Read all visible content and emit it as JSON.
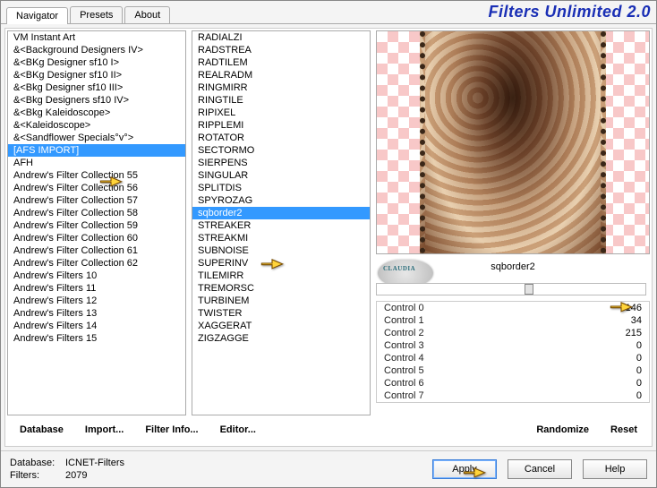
{
  "banner": "Filters Unlimited 2.0",
  "tabs": {
    "t0": "Navigator",
    "t1": "Presets",
    "t2": "About"
  },
  "categories": [
    "VM Instant Art",
    "&<Background Designers IV>",
    "&<BKg Designer sf10 I>",
    "&<BKg Designer sf10 II>",
    "&<Bkg Designer sf10 III>",
    "&<Bkg Designers sf10 IV>",
    "&<Bkg Kaleidoscope>",
    "&<Kaleidoscope>",
    "&<Sandflower Specials°v°>",
    "[AFS IMPORT]",
    "AFH",
    "Andrew's Filter Collection 55",
    "Andrew's Filter Collection 56",
    "Andrew's Filter Collection 57",
    "Andrew's Filter Collection 58",
    "Andrew's Filter Collection 59",
    "Andrew's Filter Collection 60",
    "Andrew's Filter Collection 61",
    "Andrew's Filter Collection 62",
    "Andrew's Filters 10",
    "Andrew's Filters 11",
    "Andrew's Filters 12",
    "Andrew's Filters 13",
    "Andrew's Filters 14",
    "Andrew's Filters 15"
  ],
  "categorySelectedIndex": 9,
  "filters": [
    "RADIALZI",
    "RADSTREA",
    "RADTILEM",
    "REALRADM",
    "RINGMIRR",
    "RINGTILE",
    "RIPIXEL",
    "RIPPLEMI",
    "ROTATOR",
    "SECTORMO",
    "SIERPENS",
    "SINGULAR",
    "SPLITDIS",
    "SPYROZAG",
    "sqborder2",
    "STREAKER",
    "STREAKMI",
    "SUBNOISE",
    "SUPERINV",
    "TILEMIRR",
    "TREMORSC",
    "TURBINEM",
    "TWISTER",
    "XAGGERAT",
    "ZIGZAGGE"
  ],
  "filterSelectedIndex": 14,
  "selectedFilterName": "sqborder2",
  "claudiaTag": "CLAUDIA",
  "controls": [
    {
      "label": "Control 0",
      "value": 146
    },
    {
      "label": "Control 1",
      "value": 34
    },
    {
      "label": "Control 2",
      "value": 215
    },
    {
      "label": "Control 3",
      "value": 0
    },
    {
      "label": "Control 4",
      "value": 0
    },
    {
      "label": "Control 5",
      "value": 0
    },
    {
      "label": "Control 6",
      "value": 0
    },
    {
      "label": "Control 7",
      "value": 0
    }
  ],
  "toolbar": {
    "database": "Database",
    "import": "Import...",
    "filterinfo": "Filter Info...",
    "editor": "Editor...",
    "randomize": "Randomize",
    "reset": "Reset"
  },
  "status": {
    "db_label": "Database:",
    "db_value": "ICNET-Filters",
    "filters_label": "Filters:",
    "filters_value": "2079"
  },
  "buttons": {
    "apply": "Apply",
    "cancel": "Cancel",
    "help": "Help"
  }
}
